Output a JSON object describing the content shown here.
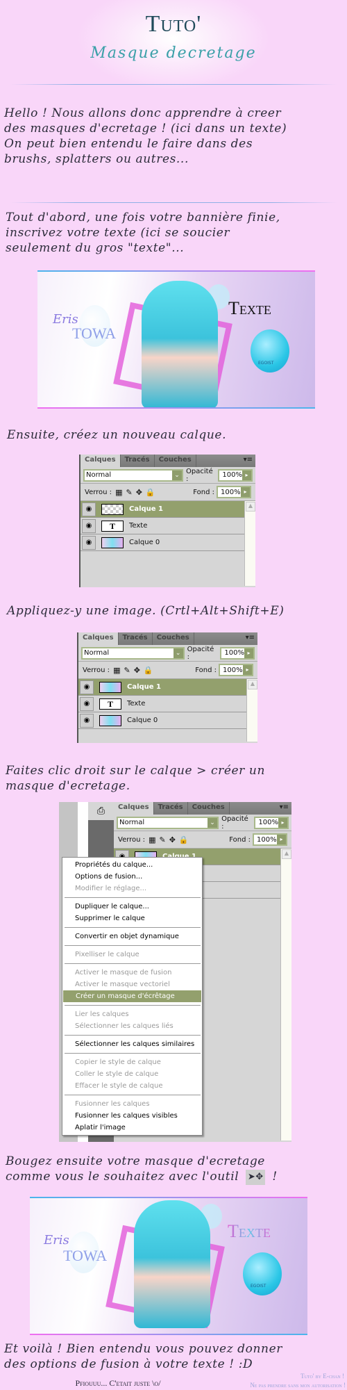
{
  "header": {
    "title": "Tuto'",
    "subtitle": "Masque decretage"
  },
  "intro": [
    "Hello ! Nous allons donc apprendre à creer",
    "des masques d'ecretage ! (ici dans un texte)",
    "On peut bien entendu le faire dans des",
    "brushs, splatters ou autres..."
  ],
  "step1": [
    "Tout d'abord, une fois votre bannière finie,",
    "inscrivez votre texte (ici se soucier",
    "seulement du gros \"texte\"..."
  ],
  "banner": {
    "eris": "Eris",
    "towa": "TOWA",
    "texte": "Texte",
    "egoist": "EGOIST"
  },
  "step2": "Ensuite, créez un nouveau calque.",
  "step3": "Appliquez-y une image. (Crtl+Alt+Shift+E)",
  "step4": [
    "Faites clic droit sur le calque > créer un",
    "masque d'ecretage."
  ],
  "step5": [
    "Bougez ensuite votre masque d'ecretage",
    "comme vous le souhaitez avec l'outil",
    "!"
  ],
  "step6": [
    "Et voilà ! Bien entendu vous pouvez donner",
    "des options de fusion à votre texte ! :D"
  ],
  "panel": {
    "tabs": [
      "Calques",
      "Tracés",
      "Couches"
    ],
    "blend_mode": "Normal",
    "opacity_label": "Opacité :",
    "opacity": "100%",
    "lock_label": "Verrou :",
    "fill_label": "Fond :",
    "fill": "100%",
    "layers": [
      "Calque 1",
      "Texte",
      "Calque 0"
    ],
    "text_thumb": "T"
  },
  "context_menu": [
    {
      "label": "Propriétés du calque...",
      "enabled": true
    },
    {
      "label": "Options de fusion...",
      "enabled": true
    },
    {
      "label": "Modifier le réglage...",
      "enabled": false
    },
    {
      "label": "Dupliquer le calque...",
      "enabled": true
    },
    {
      "label": "Supprimer le calque",
      "enabled": true
    },
    {
      "label": "Convertir en objet dynamique",
      "enabled": true
    },
    {
      "label": "Pixelliser le calque",
      "enabled": false
    },
    {
      "label": "Activer le masque de fusion",
      "enabled": false
    },
    {
      "label": "Activer le masque vectoriel",
      "enabled": false
    },
    {
      "label": "Créer un masque d'écrêtage",
      "enabled": true,
      "highlighted": true
    },
    {
      "label": "Lier les calques",
      "enabled": false
    },
    {
      "label": "Sélectionner les calques liés",
      "enabled": false
    },
    {
      "label": "Sélectionner les calques similaires",
      "enabled": true
    },
    {
      "label": "Copier le style de calque",
      "enabled": false
    },
    {
      "label": "Coller le style de calque",
      "enabled": false
    },
    {
      "label": "Effacer le style de calque",
      "enabled": false
    },
    {
      "label": "Fusionner les calques",
      "enabled": false
    },
    {
      "label": "Fusionner les calques visibles",
      "enabled": true
    },
    {
      "label": "Aplatir l'image",
      "enabled": true
    }
  ],
  "footer": {
    "left": "Pfiouuu... C'etait juste \\o/",
    "credit": "Tuto' by E-chan !",
    "notice": "Ne pas prendre sans mon autorisation !"
  },
  "colors": {
    "background": "#f9d6f9",
    "selection": "#93a06d",
    "divider": "#8fb0e6"
  }
}
